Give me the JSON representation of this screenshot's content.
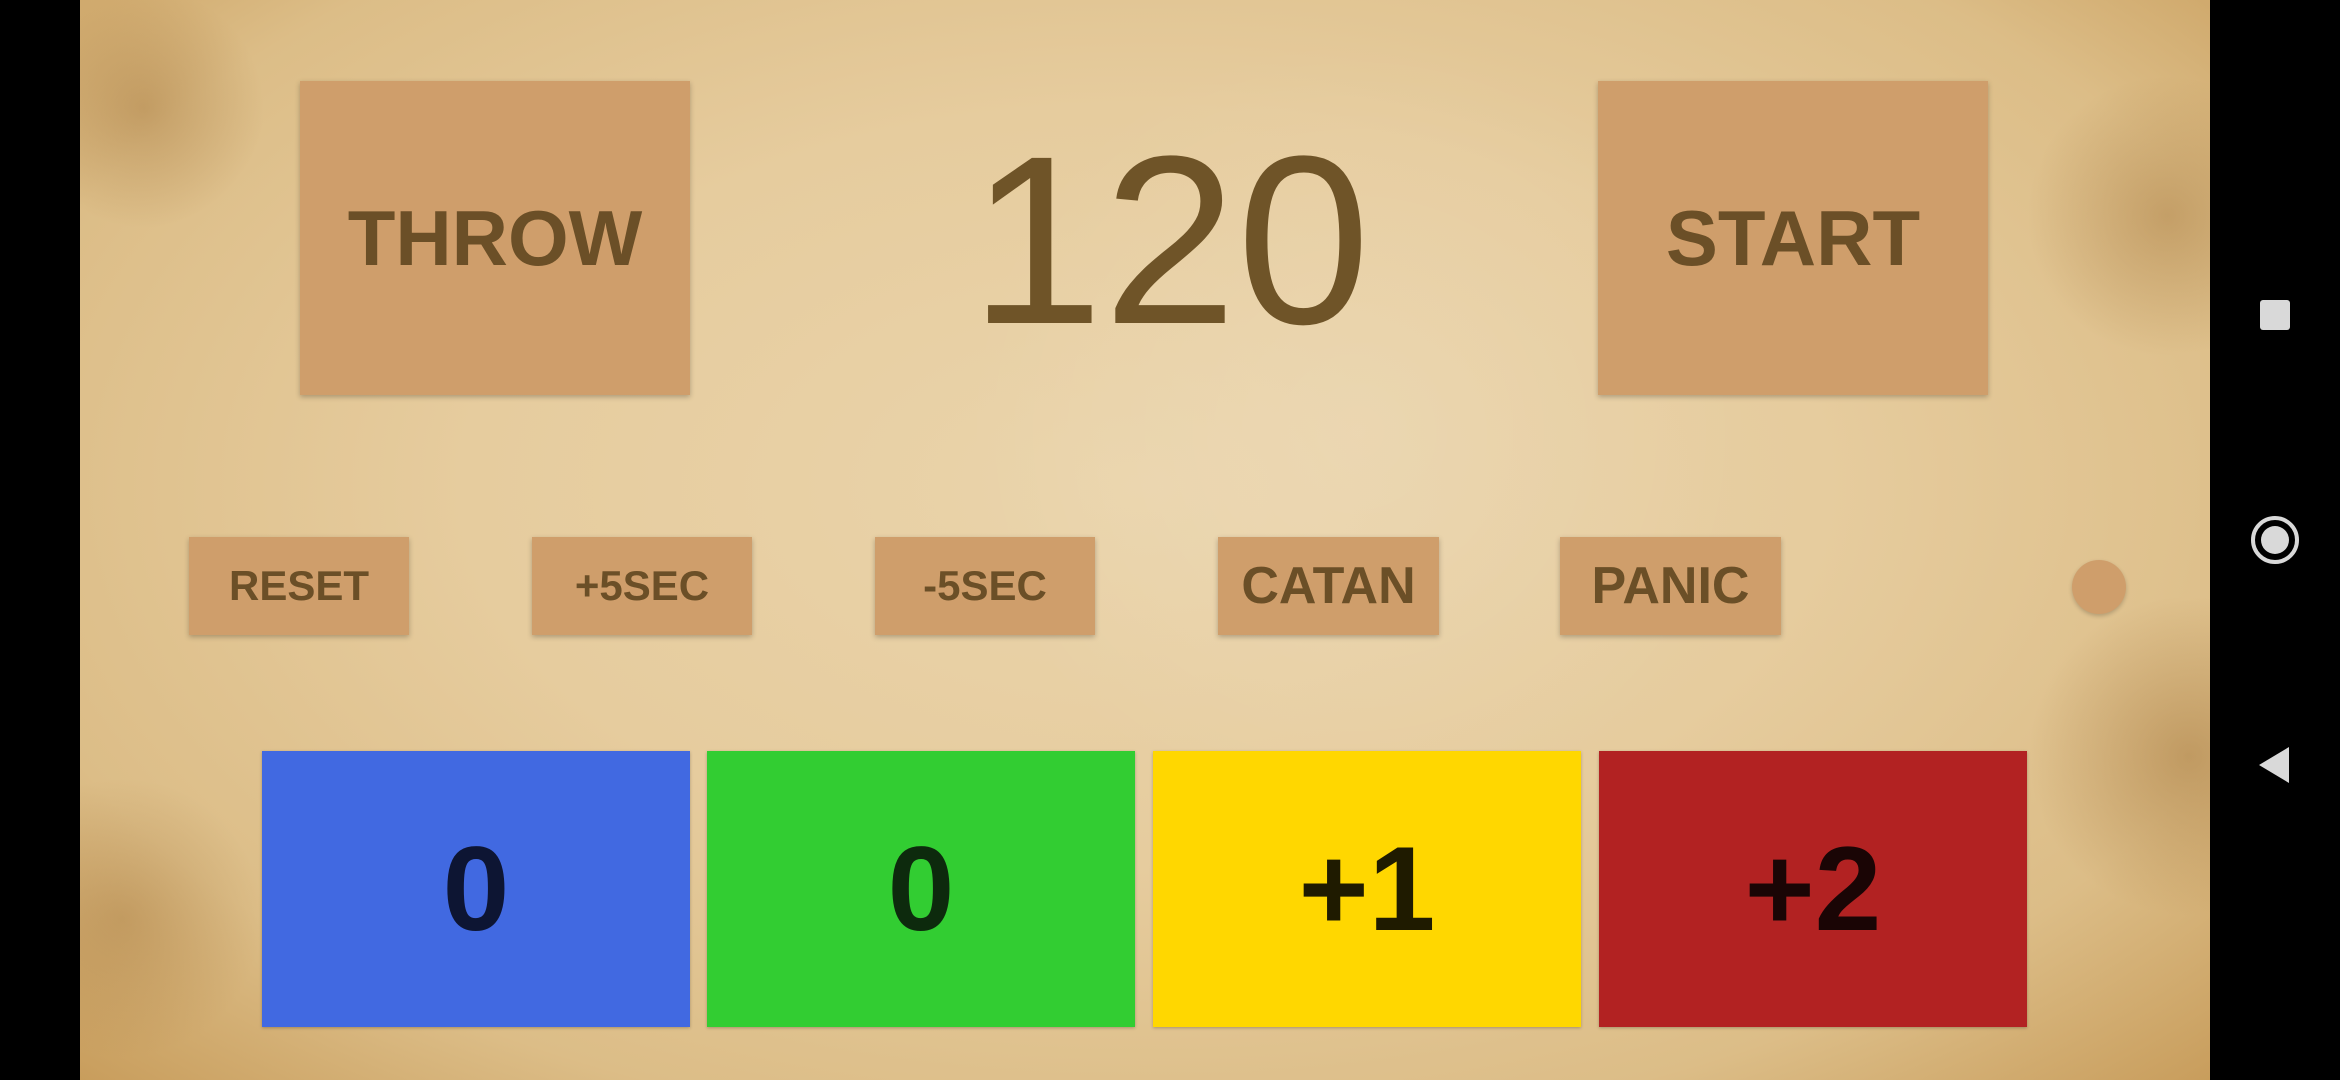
{
  "timer": {
    "value": "120"
  },
  "buttons": {
    "throw": "THROW",
    "start": "START",
    "reset": "RESET",
    "plus5": "+5SEC",
    "minus5": "-5SEC",
    "catan": "CATAN",
    "panic": "PANIC"
  },
  "scores": [
    {
      "label": "0",
      "color": "#4169e1",
      "text_color": "#0d1533"
    },
    {
      "label": "0",
      "color": "#32cd32",
      "text_color": "#0d2a0d"
    },
    {
      "label": "+1",
      "color": "#ffd700",
      "text_color": "#1f1b00"
    },
    {
      "label": "+2",
      "color": "#b22222",
      "text_color": "#1a0505"
    }
  ],
  "colors": {
    "button_bg": "#cf9e6b",
    "button_text": "#6b4f27",
    "timer_text": "#6f5428"
  },
  "system_nav": {
    "recents_icon": "square-icon",
    "home_icon": "circle-icon",
    "back_icon": "triangle-back-icon"
  }
}
